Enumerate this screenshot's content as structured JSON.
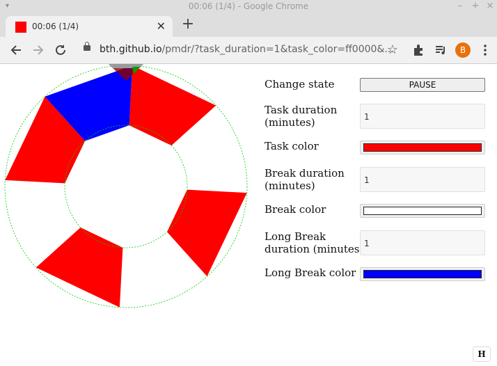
{
  "window": {
    "title": "00:06 (1/4) - Google Chrome"
  },
  "tab": {
    "title": "00:06 (1/4)",
    "favicon_color": "#ff0000"
  },
  "address": {
    "host": "bth.github.io",
    "path": "/pmdr/?task_duration=1&task_color=ff0000&..."
  },
  "profile": {
    "initial": "B",
    "color": "#e8710a"
  },
  "wheel": {
    "segments": [
      "task",
      "break",
      "task",
      "break",
      "task",
      "break",
      "task",
      "long_break"
    ],
    "task_color": "#ff0000",
    "break_color": "#ffffff",
    "long_break_color": "#0000ff",
    "outline_color": "#00cc00"
  },
  "form": {
    "change_state_label": "Change state",
    "pause_button": "PAUSE",
    "task_duration_label_1": "Task duration",
    "task_duration_label_2": "(minutes)",
    "task_duration_value": "1",
    "task_color_label": "Task color",
    "task_color": "#ff0000",
    "break_duration_label_1": "Break duration",
    "break_duration_label_2": "(minutes)",
    "break_duration_value": "1",
    "break_color_label": "Break color",
    "break_color": "#ffffff",
    "long_break_label_1": "Long Break",
    "long_break_label_2": "duration (minutes)",
    "long_break_value": "1",
    "long_break_color_label": "Long Break color",
    "long_break_color": "#0000ff"
  },
  "help_button": "H"
}
